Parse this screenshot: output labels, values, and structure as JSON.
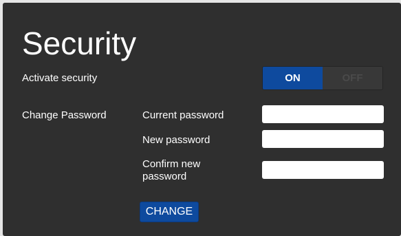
{
  "page": {
    "title": "Security"
  },
  "activate": {
    "label": "Activate security",
    "on_label": "ON",
    "off_label": "OFF",
    "state": "ON"
  },
  "change_password": {
    "section_label": "Change Password",
    "current_label": "Current password",
    "new_label": "New password",
    "confirm_label": "Confirm new password",
    "current_value": "",
    "new_value": "",
    "confirm_value": "",
    "button_label": "CHANGE"
  },
  "colors": {
    "panel_bg": "#2f2f2f",
    "accent": "#0e4a9e",
    "text": "#ffffff"
  }
}
